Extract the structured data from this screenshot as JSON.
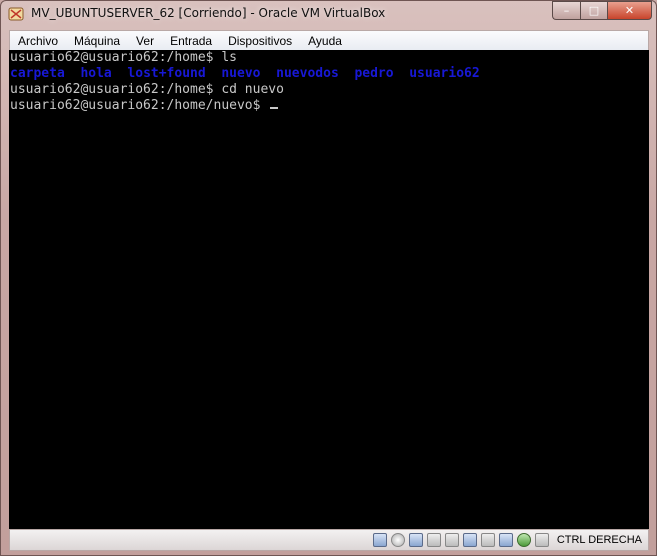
{
  "window": {
    "title": "MV_UBUNTUSERVER_62 [Corriendo] - Oracle VM VirtualBox",
    "controls": {
      "minimize": "–",
      "maximize": "□",
      "close": "✕"
    }
  },
  "menu": [
    "Archivo",
    "Máquina",
    "Ver",
    "Entrada",
    "Dispositivos",
    "Ayuda"
  ],
  "terminal": {
    "lines": [
      {
        "prompt": "usuario62@usuario62:/home$ ",
        "command": "ls"
      },
      {
        "listing": [
          "carpeta",
          "hola",
          "lost+found",
          "nuevo",
          "nuevodos",
          "pedro",
          "usuario62"
        ]
      },
      {
        "prompt": "usuario62@usuario62:/home$ ",
        "command": "cd nuevo"
      },
      {
        "prompt": "usuario62@usuario62:/home/nuevo$ ",
        "command": ""
      }
    ],
    "colors": {
      "background": "#000000",
      "text": "#c8c8c8",
      "directory": "#1818d6"
    }
  },
  "statusbar": {
    "icons": [
      "hard-disk-icon",
      "optical-drive-icon",
      "usb-icon",
      "shared-folders-icon",
      "display-icon",
      "network-icon",
      "video-capture-icon",
      "keyboard-capture-icon",
      "mouse-integration-icon",
      "host-key-arrow-icon"
    ],
    "host_key": "CTRL DERECHA"
  }
}
